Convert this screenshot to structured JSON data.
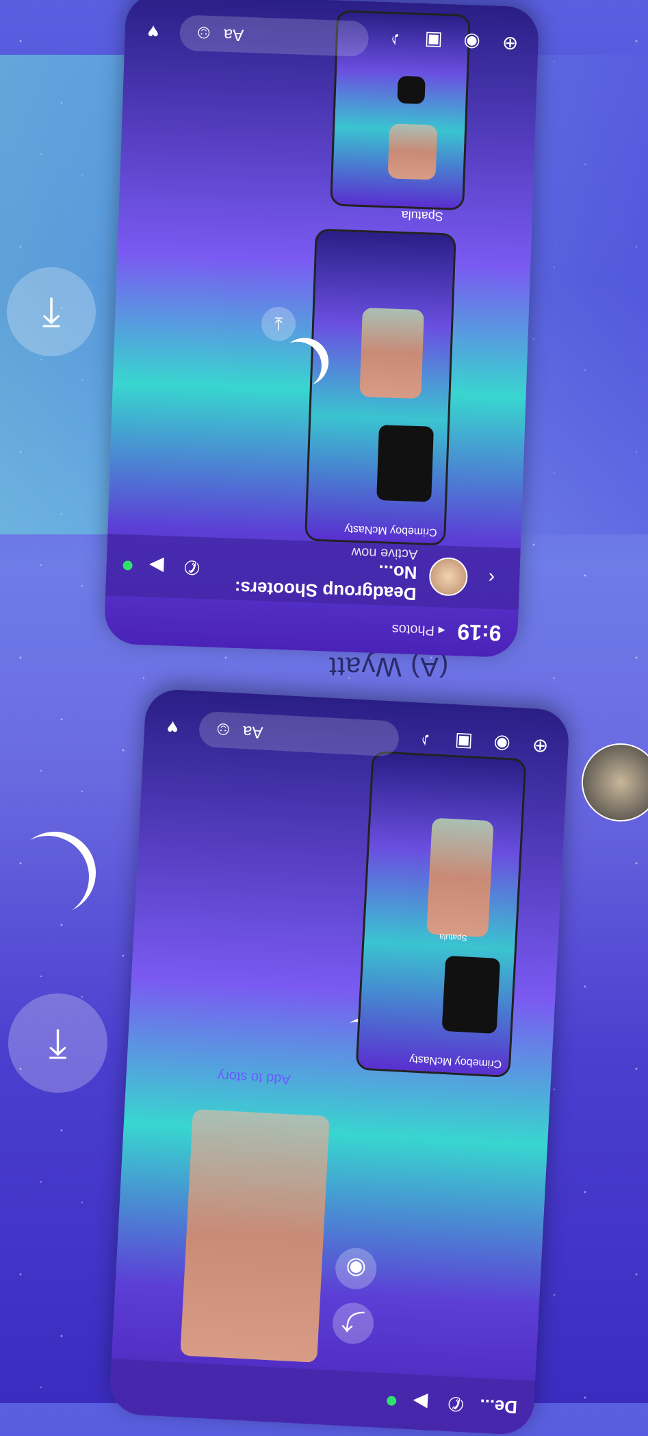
{
  "overlay": {
    "contact_name": "(A) Wyatt"
  },
  "phone1": {
    "status_time": "9:19",
    "back_label": "◂ Photos",
    "chat_title": "Deadgroup Shooters: No...",
    "chat_status": "Active now",
    "composer_placeholder": "Aa",
    "inner_sender": "Crimeboy McNasty",
    "inner_sender2": "Spatula"
  },
  "phone2": {
    "chat_title_partial": "De...",
    "composer_placeholder": "Aa",
    "inner_sender": "Crimeboy McNasty",
    "add_to_story": "Add to story",
    "inner_sender2": "Spatula"
  },
  "icons": {
    "download": "download-icon",
    "call": "phone-icon",
    "video": "video-icon",
    "emoji": "emoji-icon",
    "camera": "camera-icon",
    "image": "image-icon",
    "mic": "mic-icon",
    "share": "share-icon",
    "more": "more-icon"
  }
}
